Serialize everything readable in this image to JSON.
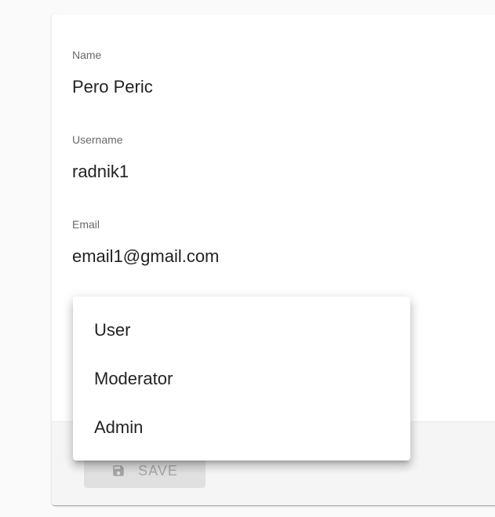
{
  "form": {
    "name": {
      "label": "Name",
      "value": "Pero Peric"
    },
    "username": {
      "label": "Username",
      "value": "radnik1"
    },
    "email": {
      "label": "Email",
      "value": "email1@gmail.com"
    }
  },
  "actions": {
    "save_label": "SAVE",
    "save_icon": "save-icon"
  },
  "role_menu": {
    "options": [
      "User",
      "Moderator",
      "Admin"
    ]
  }
}
